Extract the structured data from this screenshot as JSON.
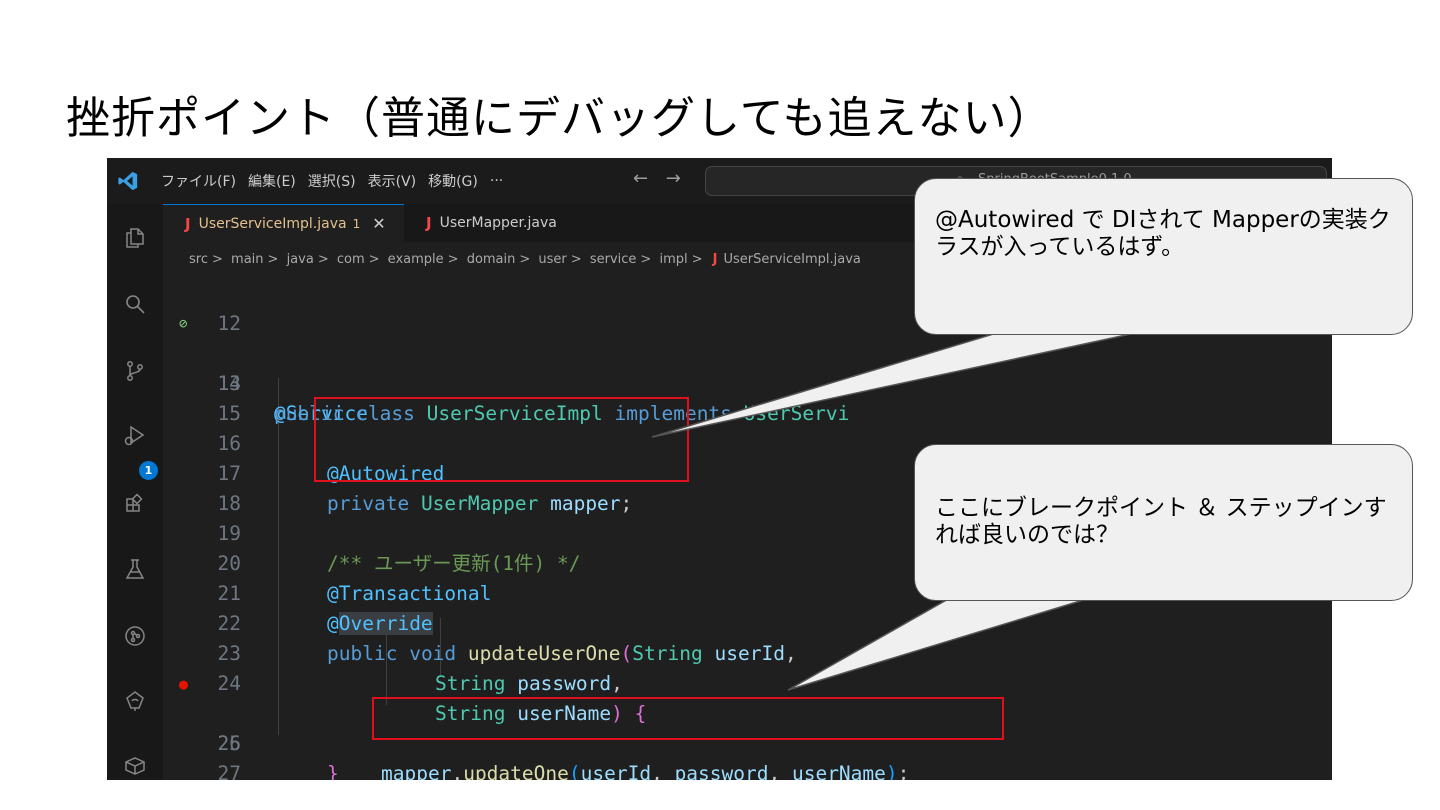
{
  "slide": {
    "title": "挫折ポイント（普通にデバッグしても追えない）"
  },
  "menu": [
    "ファイル(F)",
    "編集(E)",
    "選択(S)",
    "表示(V)",
    "移動(G)",
    "···"
  ],
  "nav_arrows": "← →",
  "command_center": {
    "text": "SpringBootSample0.1.0"
  },
  "activity_bar": {
    "icons": [
      "explorer-icon",
      "search-icon",
      "source-control-icon",
      "run-debug-icon",
      "extensions-icon",
      "testing-icon",
      "remote-explorer-icon",
      "gitlens-icon",
      "package-icon",
      "m-icon"
    ],
    "debug_badge": "1"
  },
  "tabs": [
    {
      "lang": "J",
      "name": "UserServiceImpl.java",
      "modified": "1",
      "close": "✕"
    },
    {
      "lang": "J",
      "name": "UserMapper.java"
    }
  ],
  "breadcrumb": [
    "src",
    "main",
    "java",
    "com",
    "example",
    "domain",
    "user",
    "service",
    "impl"
  ],
  "breadcrumb_file": {
    "lang": "J",
    "name": "UserServiceImpl.java"
  },
  "code": {
    "line_numbers": [
      "12",
      "13",
      "14",
      "15",
      "16",
      "17",
      "18",
      "19",
      "20",
      "21",
      "22",
      "23",
      "24",
      "25",
      "26",
      "27"
    ],
    "lines": {
      "l13": [
        "@Service"
      ],
      "l14": [
        "public",
        " ",
        "class",
        " ",
        "UserServiceImpl",
        " ",
        "implements",
        " ",
        "UserServi"
      ],
      "l16": [
        "@Autowired"
      ],
      "l17": [
        "private",
        " ",
        "UserMapper",
        " ",
        "mapper",
        ";"
      ],
      "l19": [
        "/** ユーザー更新(1件) */"
      ],
      "l20": [
        "@Transactional"
      ],
      "l21": [
        "@",
        "Override"
      ],
      "l22": [
        "public",
        " ",
        "void",
        " ",
        "updateUserOne",
        "(",
        "String",
        " ",
        "userId",
        ","
      ],
      "l23": [
        "String",
        " ",
        "password",
        ","
      ],
      "l24": [
        "String",
        " ",
        "userName",
        ")",
        " ",
        "{"
      ],
      "l25": [
        "mapper",
        ".",
        "updateOne",
        "(",
        "userId",
        ", ",
        "password",
        ", ",
        "userName",
        ")",
        ";"
      ],
      "l26": [
        "}"
      ]
    }
  },
  "callouts": [
    {
      "text": "@Autowired で DIされて Mapperの実装クラスが入っているはず。"
    },
    {
      "text": "ここにブレークポイント ＆ ステップインすれば良いのでは？"
    }
  ],
  "colors": {
    "editor_bg": "#1f1f1f",
    "highlight_box": "#e0101d",
    "callout_bg": "#f0f0f0",
    "accent": "#0078d4"
  }
}
